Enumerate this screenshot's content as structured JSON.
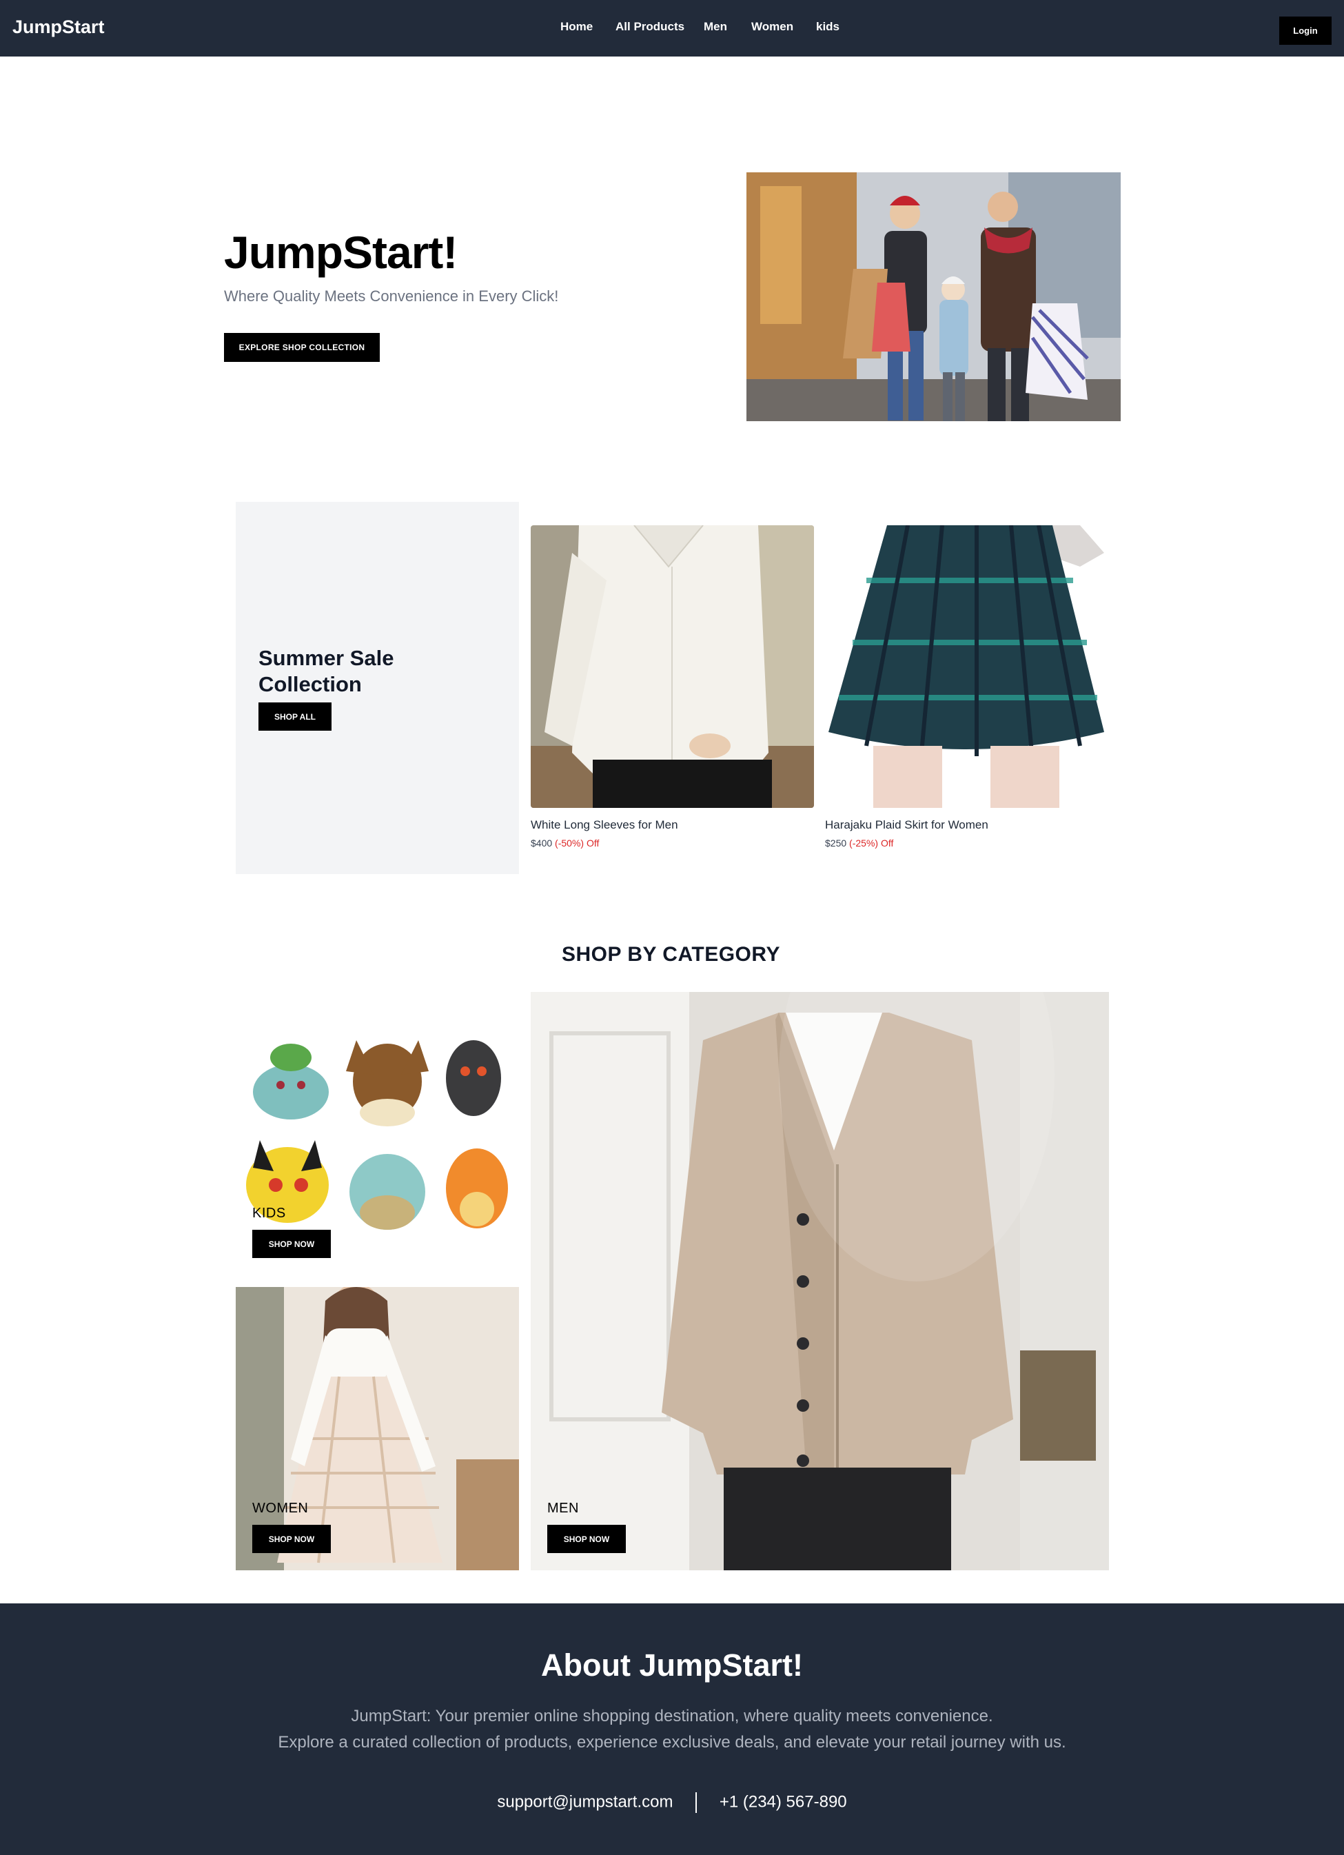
{
  "header": {
    "brand": "JumpStart",
    "nav": [
      "Home",
      "All Products",
      "Men",
      "Women",
      "kids"
    ],
    "login_label": "Login"
  },
  "hero": {
    "title": "JumpStart!",
    "subtitle": "Where Quality Meets Convenience in Every Click!",
    "cta_label": "EXPLORE SHOP COLLECTION"
  },
  "sale": {
    "title": "Summer Sale Collection",
    "cta_label": "SHOP ALL",
    "products": [
      {
        "name": "White Long Sleeves for Men",
        "price": "$400",
        "discount": "(-50%) Off"
      },
      {
        "name": "Harajaku Plaid Skirt for Women",
        "price": "$250",
        "discount": "(-25%) Off"
      }
    ]
  },
  "categories": {
    "heading": "SHOP BY CATEGORY",
    "kids": {
      "label": "KIDS",
      "cta_label": "SHOP NOW"
    },
    "women": {
      "label": "WOMEN",
      "cta_label": "SHOP NOW"
    },
    "men": {
      "label": "MEN",
      "cta_label": "SHOP NOW"
    }
  },
  "footer": {
    "title": "About JumpStart!",
    "line1": "JumpStart: Your premier online shopping destination, where quality meets convenience.",
    "line2": "Explore a curated collection of products, experience exclusive deals, and elevate your retail journey with us.",
    "email": "support@jumpstart.com",
    "phone": "+1 (234) 567-890"
  },
  "colors": {
    "nav_bg": "#222b3a",
    "button_bg": "#000000",
    "sale_panel_bg": "#f3f4f6",
    "discount": "#dc2626"
  }
}
